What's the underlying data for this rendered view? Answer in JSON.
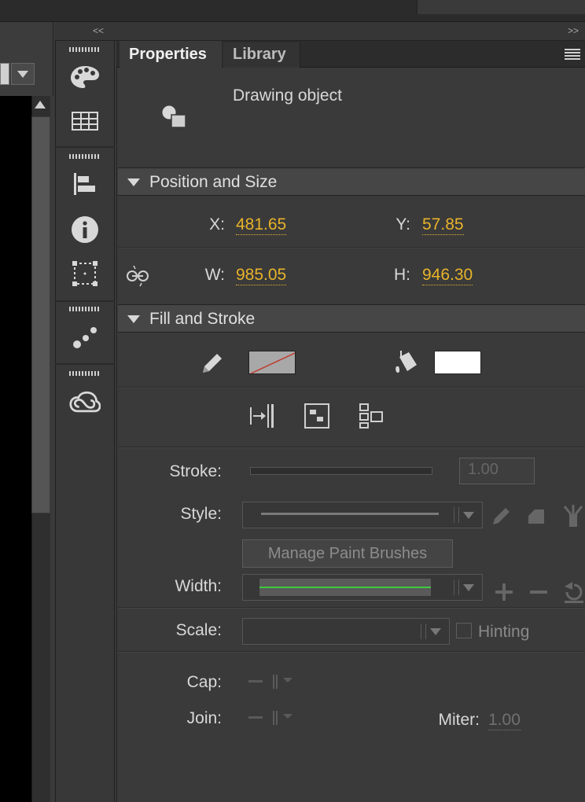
{
  "window": {
    "collapse_left": "<<",
    "collapse_right": ">>"
  },
  "tabs": [
    {
      "label": "Properties",
      "active": true
    },
    {
      "label": "Library",
      "active": false
    }
  ],
  "object": {
    "type_label": "Drawing object"
  },
  "position_size": {
    "title": "Position and Size",
    "x_label": "X:",
    "x_value": "481.65",
    "y_label": "Y:",
    "y_value": "57.85",
    "w_label": "W:",
    "w_value": "985.05",
    "h_label": "H:",
    "h_value": "946.30"
  },
  "fill_stroke": {
    "title": "Fill and Stroke",
    "stroke_color": "none",
    "fill_color": "#ffffff",
    "stroke_label": "Stroke:",
    "stroke_value": "1.00",
    "style_label": "Style:",
    "manage_brushes_label": "Manage Paint Brushes",
    "width_label": "Width:",
    "width_line_color": "#3ec93e",
    "scale_label": "Scale:",
    "hinting_label": "Hinting",
    "cap_label": "Cap:",
    "join_label": "Join:",
    "miter_label": "Miter:",
    "miter_value": "1.00"
  },
  "colors": {
    "accent_value": "#e8b32a",
    "panel_bg": "#3a3a3a"
  }
}
